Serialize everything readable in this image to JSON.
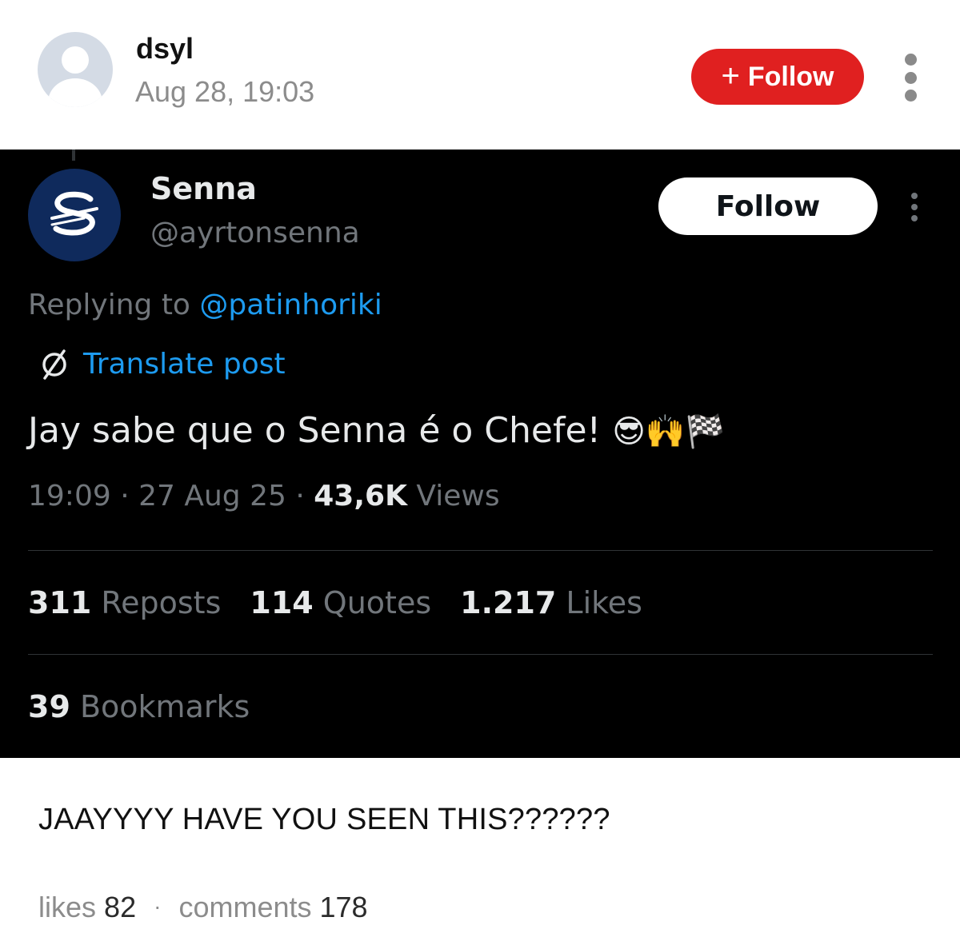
{
  "post": {
    "username": "dsyl",
    "timestamp": "Aug 28, 19:03",
    "follow_label": "Follow",
    "caption": "JAAYYYY HAVE YOU SEEN THIS??????",
    "likes_label": "likes",
    "likes_count": "82",
    "separator": "·",
    "comments_label": "comments",
    "comments_count": "178"
  },
  "tweet": {
    "display_name": "Senna",
    "handle": "@ayrtonsenna",
    "follow_label": "Follow",
    "replying_prefix": "Replying to",
    "replying_to": "@patinhoriki",
    "translate_label": "Translate post",
    "body_text": "Jay sabe que o Senna é o Chefe!",
    "body_emojis": "😎🙌🏁",
    "time": "19:09",
    "date": "27 Aug 25",
    "meta_sep": " · ",
    "views_count": "43,6K",
    "views_label": "Views",
    "reposts_count": "311",
    "reposts_label": "Reposts",
    "quotes_count": "114",
    "quotes_label": "Quotes",
    "likes_count": "1.217",
    "likes_label": "Likes",
    "bookmarks_count": "39",
    "bookmarks_label": "Bookmarks"
  },
  "icons": {
    "avatar": "user-silhouette-icon",
    "follow_plus": "plus-icon",
    "more": "vertical-ellipsis-icon",
    "logo": "senna-s-logo",
    "translate": "globe-slash-icon"
  },
  "colors": {
    "follow_red": "#e02020",
    "link_blue": "#1d9bf0",
    "tweet_bg": "#000000",
    "muted_gray": "#71767b"
  }
}
